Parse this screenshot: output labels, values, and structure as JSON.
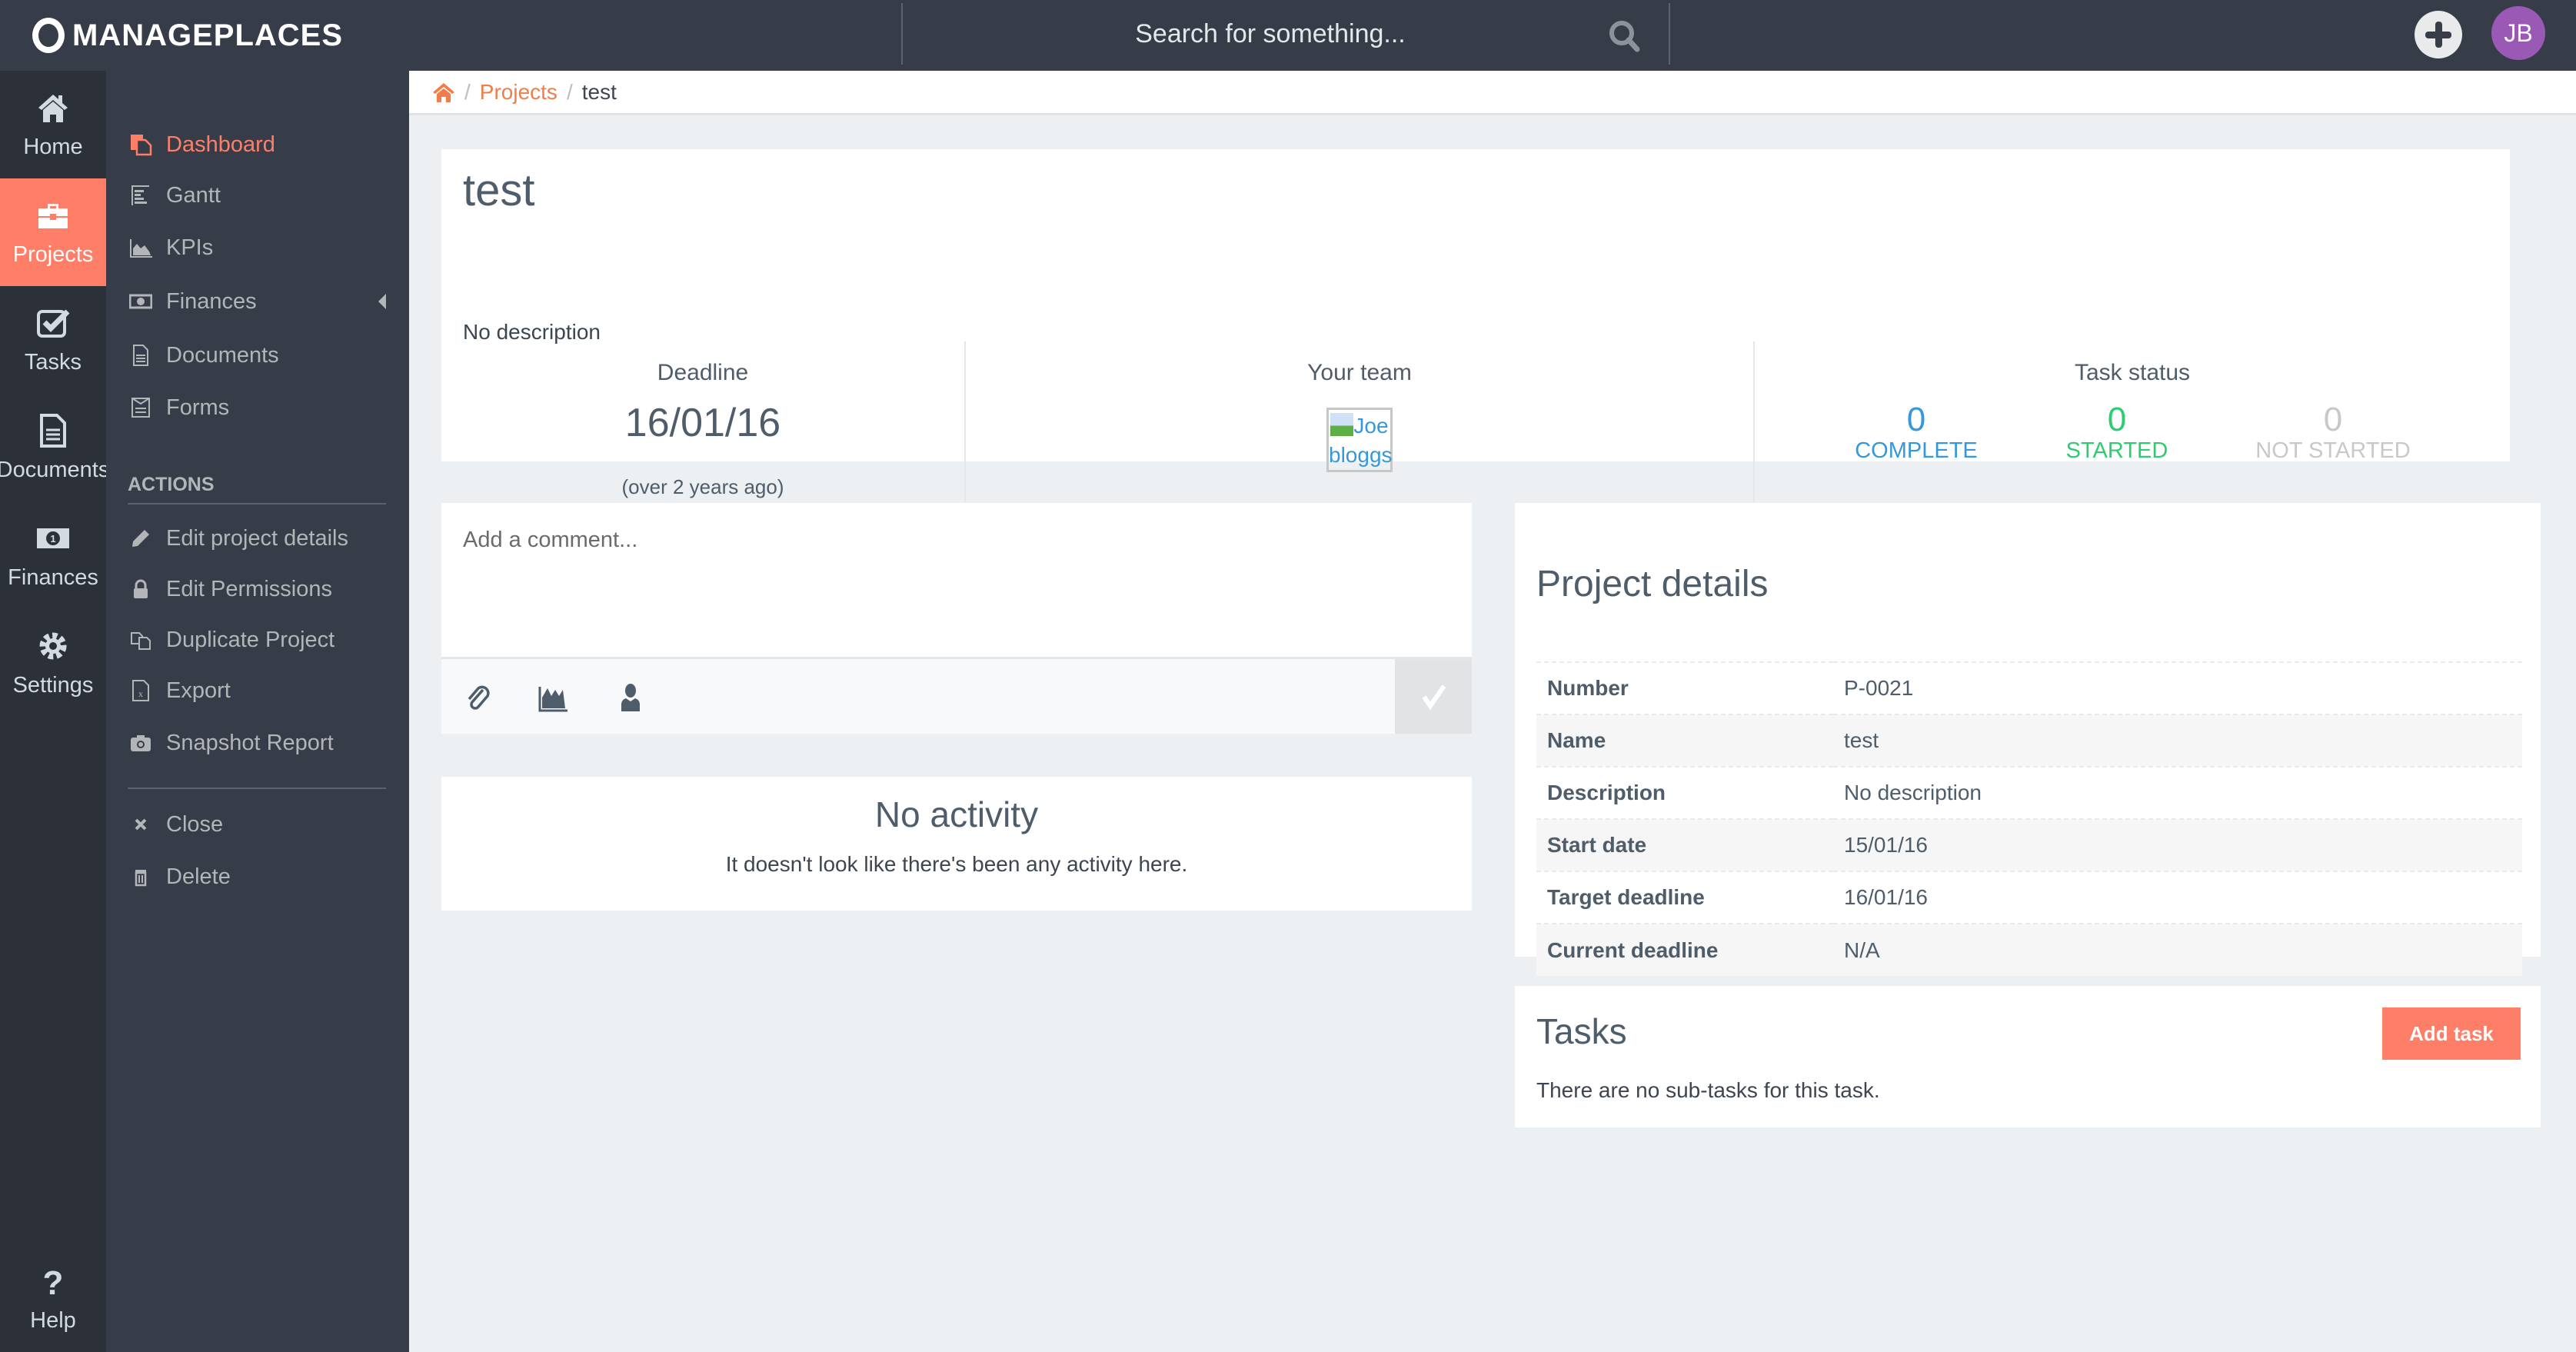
{
  "app": {
    "name": "MANAGEPLACES"
  },
  "topbar": {
    "search_placeholder": "Search for something...",
    "user_initials": "JB",
    "colors": {
      "avatar": "#9b59b6",
      "bar": "#363d48"
    }
  },
  "primary_nav": [
    {
      "label": "Home",
      "icon": "home-icon"
    },
    {
      "label": "Projects",
      "icon": "briefcase-icon",
      "active": true
    },
    {
      "label": "Tasks",
      "icon": "checkbox-icon"
    },
    {
      "label": "Documents",
      "icon": "document-icon"
    },
    {
      "label": "Finances",
      "icon": "money-icon"
    },
    {
      "label": "Settings",
      "icon": "gear-icon"
    },
    {
      "label": "Help",
      "icon": "question-icon"
    }
  ],
  "secondary_nav": {
    "items": [
      {
        "label": "Dashboard",
        "icon": "dashboard-icon",
        "active": true
      },
      {
        "label": "Gantt",
        "icon": "gantt-icon"
      },
      {
        "label": "KPIs",
        "icon": "area-chart-icon"
      },
      {
        "label": "Finances",
        "icon": "money-icon",
        "has_submenu": true
      },
      {
        "label": "Documents",
        "icon": "document-icon"
      },
      {
        "label": "Forms",
        "icon": "form-icon"
      }
    ],
    "actions_heading": "ACTIONS",
    "actions": [
      {
        "label": "Edit project details",
        "icon": "pencil-icon"
      },
      {
        "label": "Edit Permissions",
        "icon": "lock-icon"
      },
      {
        "label": "Duplicate Project",
        "icon": "copy-icon"
      },
      {
        "label": "Export",
        "icon": "excel-file-icon"
      },
      {
        "label": "Snapshot Report",
        "icon": "camera-icon"
      }
    ],
    "danger_actions": [
      {
        "label": "Close",
        "icon": "close-icon"
      },
      {
        "label": "Delete",
        "icon": "trash-icon"
      }
    ]
  },
  "breadcrumb": {
    "separator": "/",
    "items": [
      {
        "label": "Projects",
        "link": true
      },
      {
        "label": "test",
        "link": false
      }
    ]
  },
  "project": {
    "title": "test",
    "description": "No description",
    "deadline_label": "Deadline",
    "deadline": "16/01/16",
    "deadline_relative": "(over 2 years ago)",
    "team_label": "Your team",
    "team": [
      {
        "name": "Joe bloggs"
      }
    ],
    "task_status_label": "Task status",
    "task_status": [
      {
        "label": "COMPLETE",
        "count": "0",
        "color": "#3498db"
      },
      {
        "label": "STARTED",
        "count": "0",
        "color": "#2ecc71"
      },
      {
        "label": "NOT STARTED",
        "count": "0",
        "color": "#c8c8c8"
      }
    ]
  },
  "comment": {
    "placeholder": "Add a comment...",
    "toolbar": [
      "paperclip-icon",
      "chart-icon",
      "user-icon"
    ]
  },
  "activity": {
    "title": "No activity",
    "text": "It doesn't look like there's been any activity here."
  },
  "details": {
    "title": "Project details",
    "rows": [
      {
        "key": "Number",
        "value": "P-0021"
      },
      {
        "key": "Name",
        "value": "test"
      },
      {
        "key": "Description",
        "value": "No description"
      },
      {
        "key": "Start date",
        "value": "15/01/16"
      },
      {
        "key": "Target deadline",
        "value": "16/01/16"
      },
      {
        "key": "Current deadline",
        "value": "N/A"
      }
    ]
  },
  "tasks": {
    "title": "Tasks",
    "add_label": "Add task",
    "empty_text": "There are no sub-tasks for this task.",
    "accent": "#ff7e67"
  }
}
